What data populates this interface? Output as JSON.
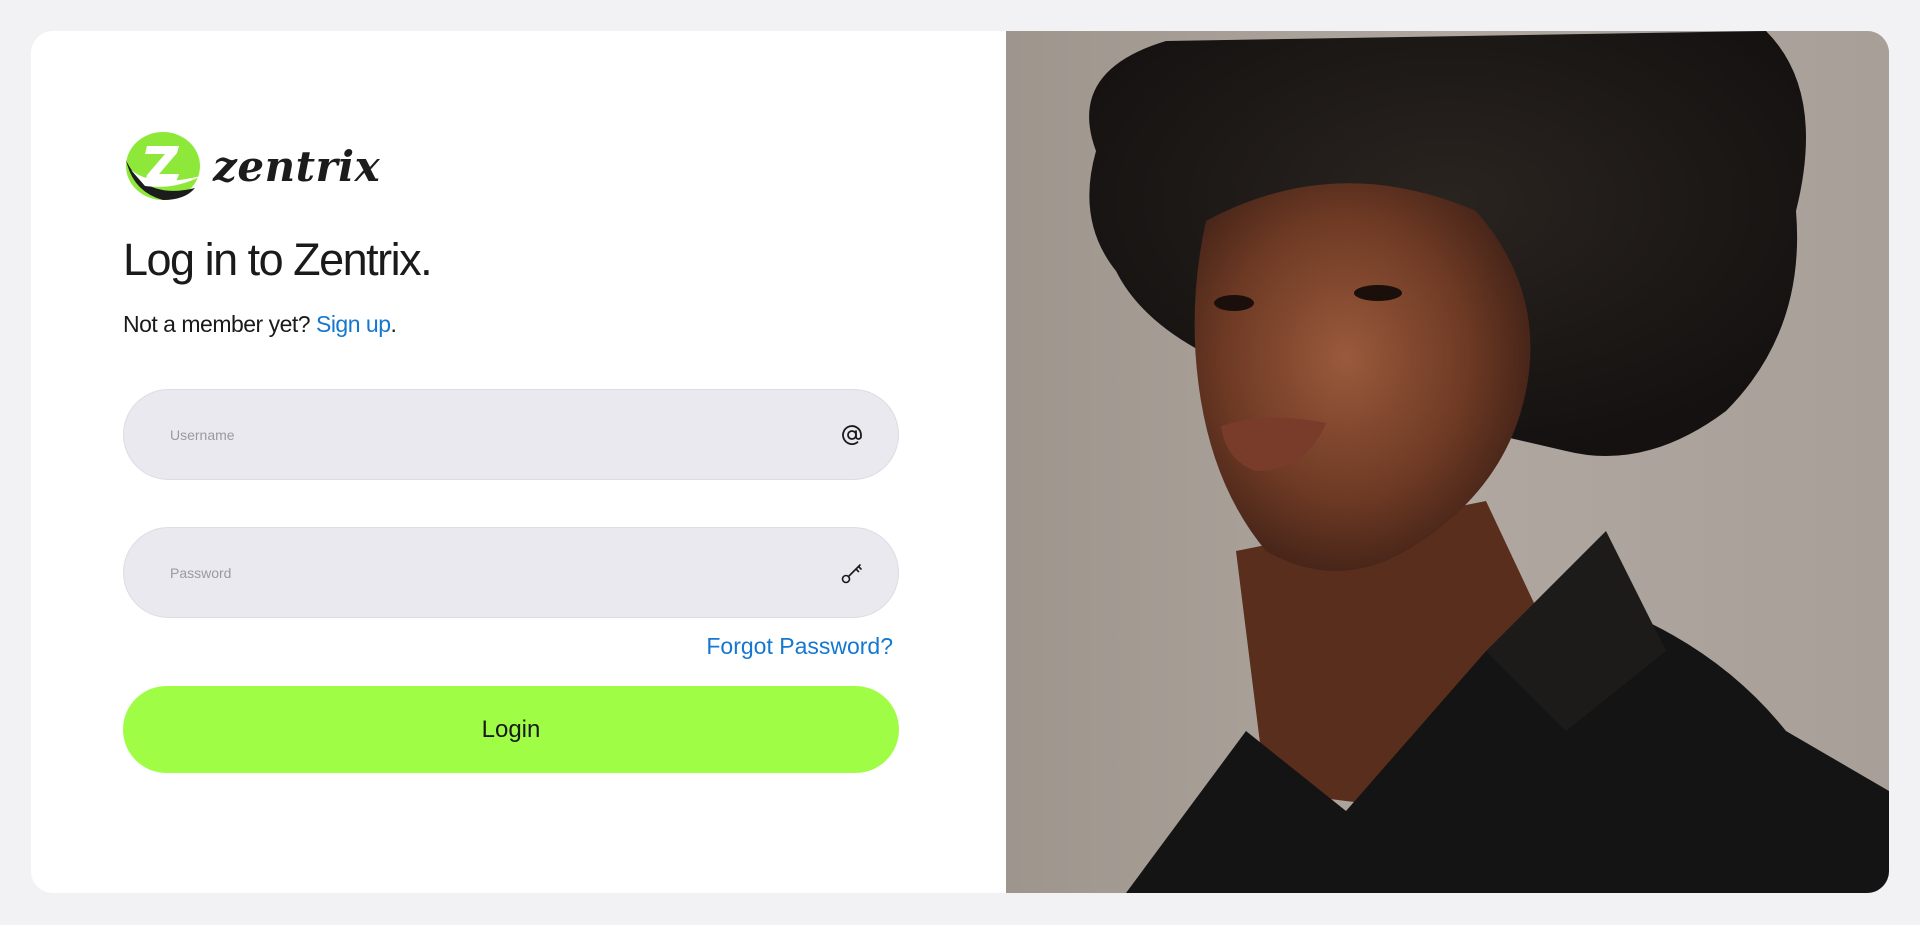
{
  "brand": {
    "name": "zentrix",
    "logo_icon": "zentrix-logo",
    "accent_color": "#9ffd45",
    "dark_color": "#1c1c1c"
  },
  "heading": {
    "title": "Log in to Zentrix.",
    "subtitle_prefix": "Not a member yet?",
    "signup_link": "Sign up",
    "subtitle_suffix": "."
  },
  "form": {
    "username": {
      "placeholder": "Username",
      "value": "",
      "icon": "at-icon"
    },
    "password": {
      "placeholder": "Password",
      "value": "",
      "icon": "key-icon"
    },
    "forgot_label": "Forgot Password?",
    "login_label": "Login"
  },
  "link_color": "#1577d0",
  "hero_image": {
    "description_icon": "portrait-photo"
  }
}
